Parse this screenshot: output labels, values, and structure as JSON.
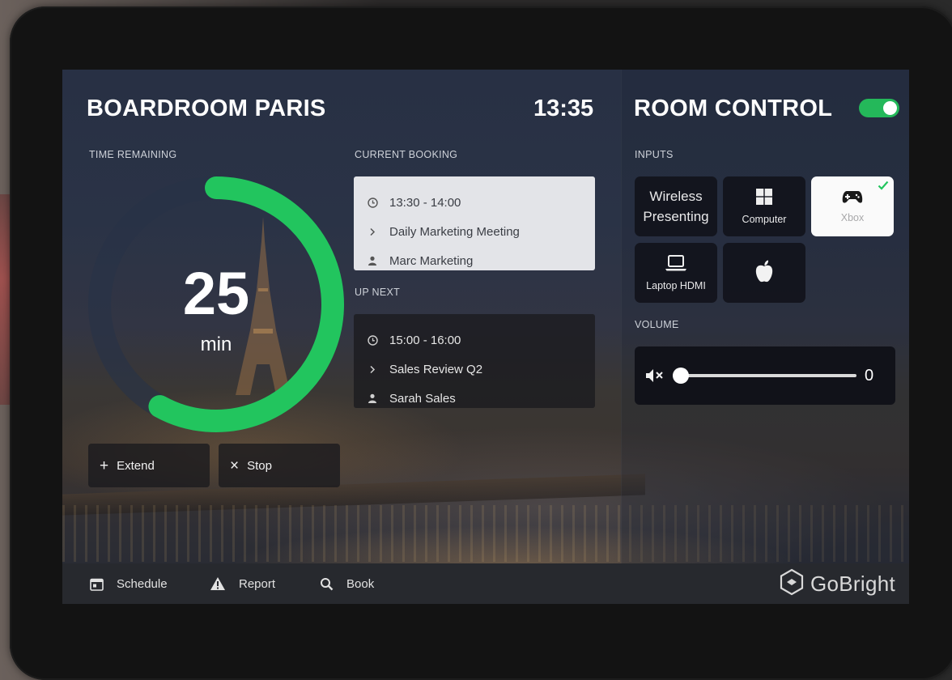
{
  "header": {
    "room_name": "BOARDROOM PARIS",
    "clock": "13:35"
  },
  "timer": {
    "label": "TIME REMAINING",
    "value": "25",
    "unit": "min",
    "fraction_elapsed": 0.42,
    "accent": "#22c55e"
  },
  "actions": {
    "extend_label": "Extend",
    "stop_label": "Stop"
  },
  "current_booking": {
    "label": "CURRENT BOOKING",
    "time": "13:30 - 14:00",
    "title": "Daily Marketing Meeting",
    "organizer": "Marc Marketing"
  },
  "up_next": {
    "label": "UP NEXT",
    "time": "15:00 - 16:00",
    "title": "Sales Review Q2",
    "organizer": "Sarah Sales"
  },
  "room_control": {
    "title": "ROOM CONTROL",
    "toggle_on": true,
    "inputs_label": "INPUTS",
    "inputs": [
      {
        "label": "Wireless Presenting",
        "icon": "wireless-icon",
        "selected": false
      },
      {
        "label": "Computer",
        "icon": "windows-icon",
        "selected": false
      },
      {
        "label": "Xbox",
        "icon": "gamepad-icon",
        "selected": true
      },
      {
        "label": "Laptop HDMI",
        "icon": "laptop-icon",
        "selected": false
      },
      {
        "label": "",
        "icon": "apple-icon",
        "selected": false
      }
    ],
    "volume_label": "VOLUME",
    "volume_value": "0",
    "volume_level": 0
  },
  "nav": {
    "schedule": "Schedule",
    "report": "Report",
    "book": "Book"
  },
  "brand": {
    "name": "GoBright"
  },
  "colors": {
    "accent_green": "#22c55e",
    "card_light": "#e3e4e8",
    "bar": "#27292e"
  }
}
